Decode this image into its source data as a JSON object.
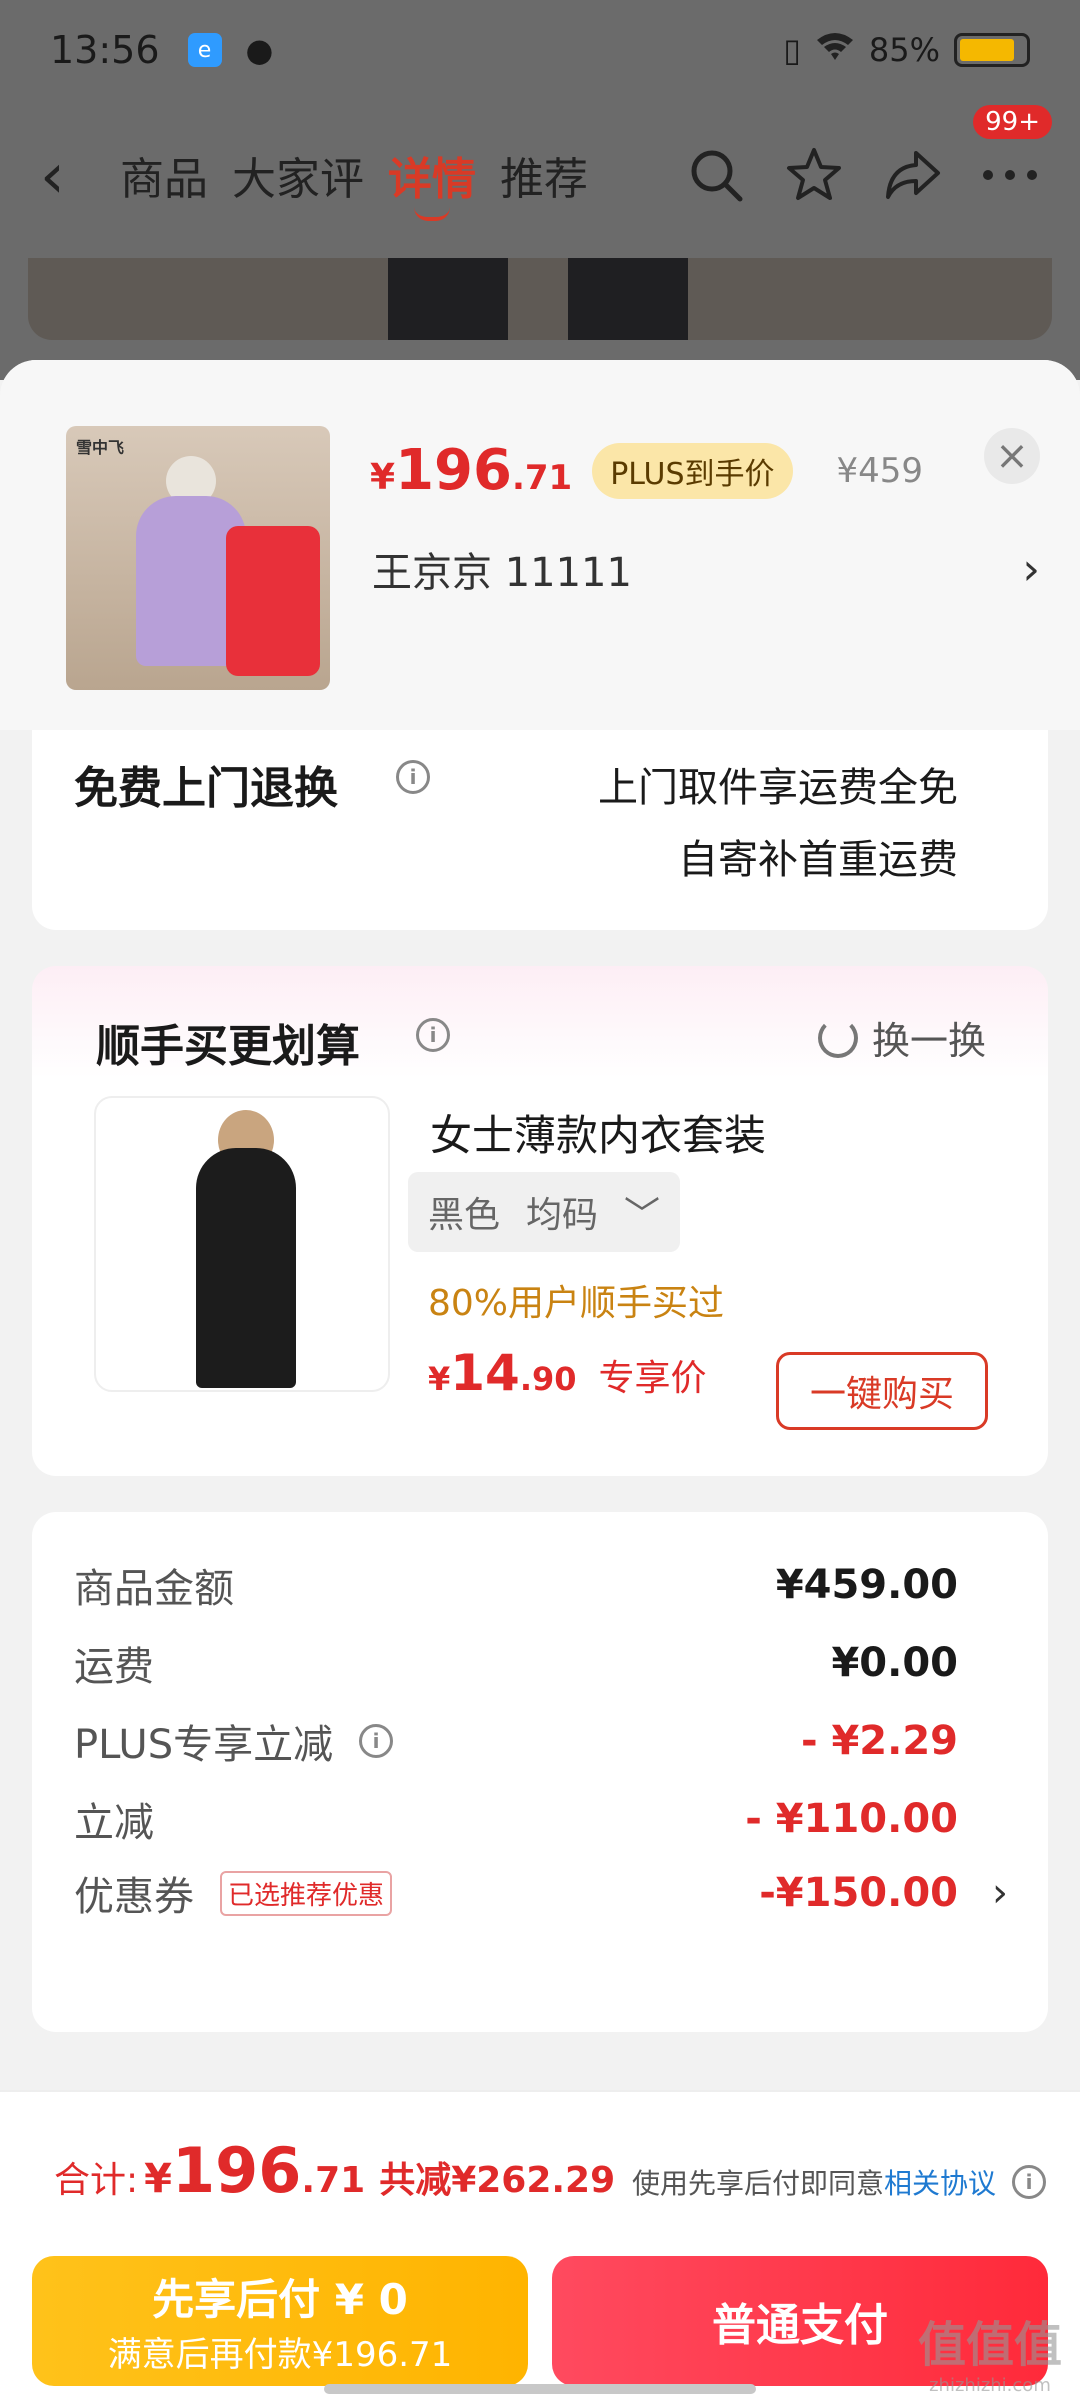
{
  "status_bar": {
    "time": "13:56",
    "battery": "85%",
    "battery_level": 0.85
  },
  "nav": {
    "back": "‹",
    "tabs": [
      "商品",
      "大家评",
      "详情",
      "推荐"
    ],
    "active_tab": "详情",
    "badge": "99+",
    "icons": [
      "search-icon",
      "star-icon",
      "share-icon",
      "more-icon"
    ]
  },
  "product": {
    "price_symbol": "¥",
    "price_int": "196",
    "price_dec": ".71",
    "plus_label": "PLUS到手价",
    "original_price": "¥459",
    "spec": "王京京  11111",
    "close": "×"
  },
  "returns": {
    "title": "免费上门退换",
    "line1": "上门取件享运费全免",
    "line2": "自寄补首重运费"
  },
  "addon": {
    "title": "顺手买更划算",
    "swap": "换一换",
    "name": "女士薄款内衣套装",
    "color": "黑色",
    "size": "均码",
    "social": "80%用户顺手买过",
    "price_symbol": "¥",
    "price_int": "14",
    "price_dec": ".90",
    "price_tag": "专享价",
    "buy": "一键购买"
  },
  "summary": {
    "rows": [
      {
        "label": "商品金额",
        "value": "¥459.00"
      },
      {
        "label": "运费",
        "value": "¥0.00"
      },
      {
        "label": "PLUS专享立减",
        "value": "- ¥2.29"
      },
      {
        "label": "立减",
        "value": "- ¥110.00"
      },
      {
        "label": "优惠券",
        "value": "-¥150.00",
        "tag": "已选推荐优惠"
      }
    ]
  },
  "footer": {
    "total_label": "合计:",
    "total_symbol": "¥",
    "total_int": "196",
    "total_dec": ".71",
    "savings": "共减¥262.29",
    "agree_text": "使用先享后付即同意",
    "agree_link": "相关协议",
    "later_line1": "先享后付 ¥ 0",
    "later_line2": "满意后再付款¥196.71",
    "pay": "普通支付"
  },
  "colors": {
    "accent_red": "#e02a2a",
    "pay_later_yellow": "#ffb400",
    "social_orange": "#c98312"
  }
}
